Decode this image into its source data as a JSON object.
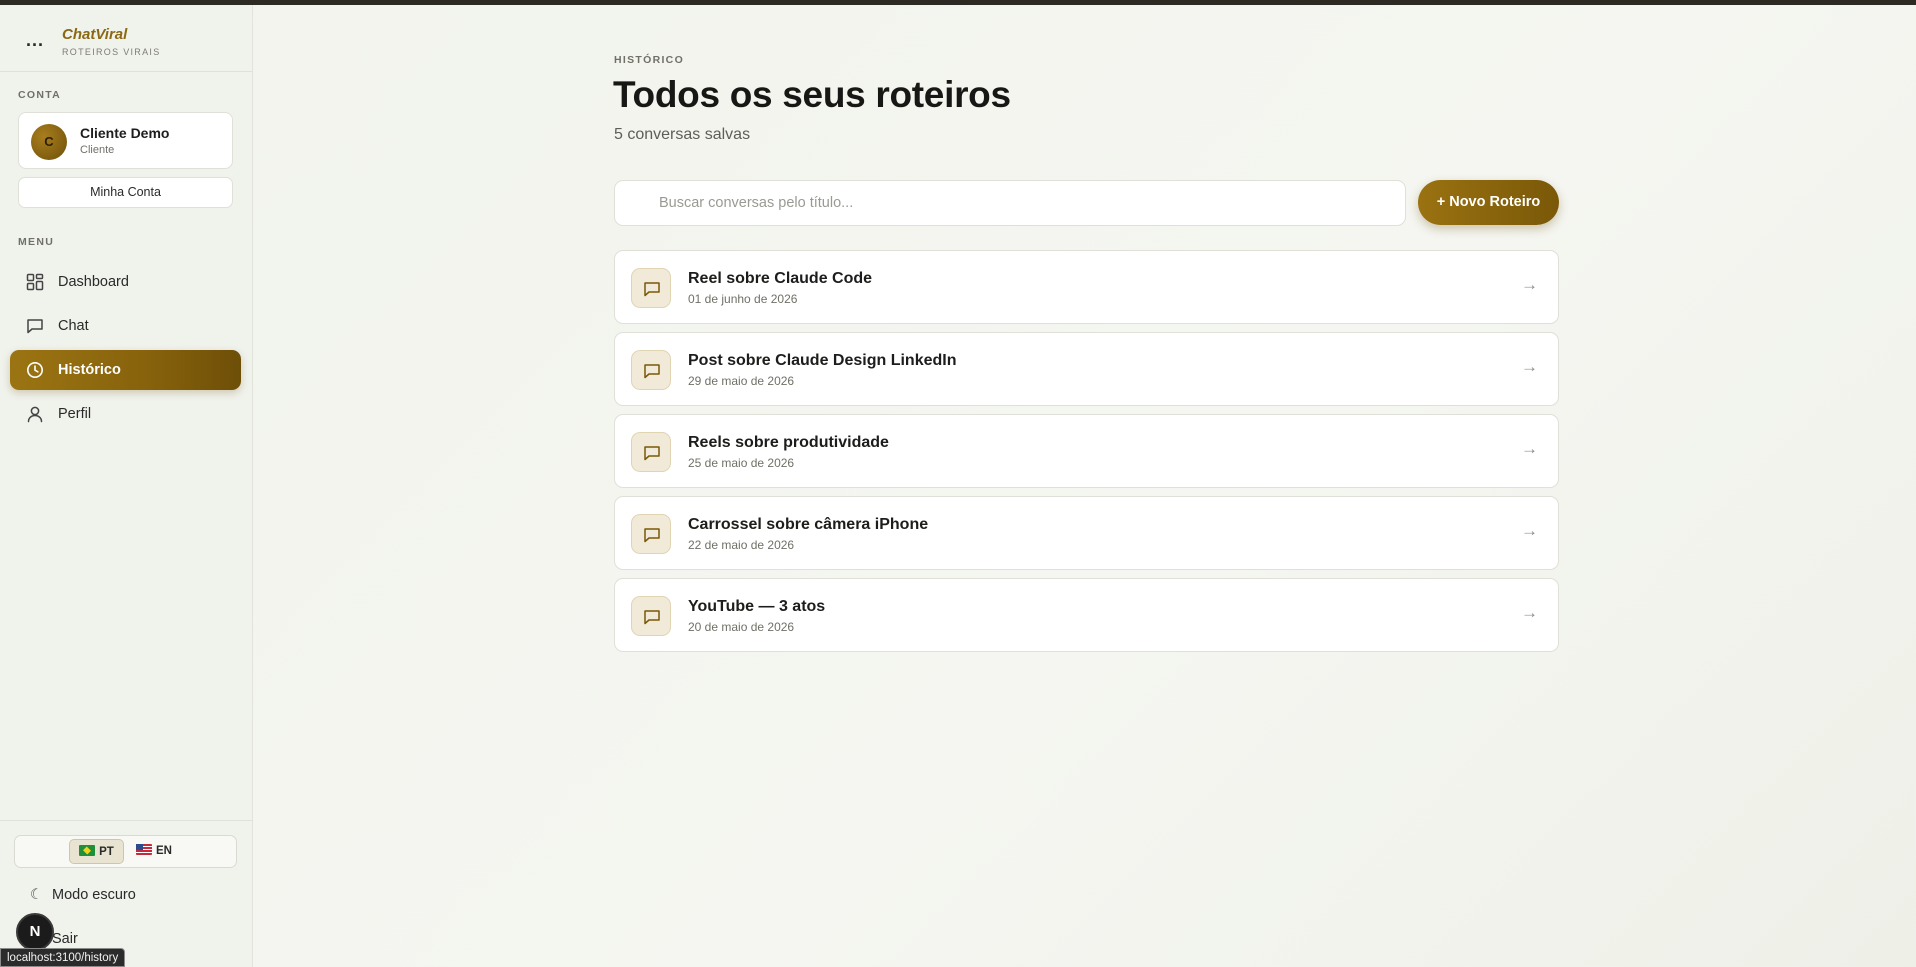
{
  "brand": {
    "name": "ChatViral",
    "tagline": "ROTEIROS VIRAIS",
    "menu_glyph": "..."
  },
  "account": {
    "section_label": "CONTA",
    "avatar_initial": "C",
    "name": "Cliente Demo",
    "role": "Cliente",
    "button_label": "Minha Conta"
  },
  "menu": {
    "section_label": "MENU",
    "items": [
      {
        "label": "Dashboard",
        "icon": "grid-icon",
        "active": false
      },
      {
        "label": "Chat",
        "icon": "chat-icon",
        "active": false
      },
      {
        "label": "Histórico",
        "icon": "clock-icon",
        "active": true
      },
      {
        "label": "Perfil",
        "icon": "user-icon",
        "active": false
      }
    ]
  },
  "language": {
    "pt_label": "PT",
    "en_label": "EN",
    "selected": "PT"
  },
  "bottom": {
    "dark_mode_label": "Modo escuro",
    "dark_mode_glyph": "☾",
    "logout_label": "Sair"
  },
  "overlay": {
    "badge": "N",
    "status_url": "localhost:3100/history"
  },
  "header": {
    "eyebrow": "HISTÓRICO",
    "title": "Todos os seus roteiros",
    "subtitle": "5 conversas salvas"
  },
  "search": {
    "placeholder": "Buscar conversas pelo título...",
    "value": ""
  },
  "new_button_label": "+ Novo Roteiro",
  "conversations": [
    {
      "title": "Reel sobre Claude Code",
      "date": "01 de junho de 2026"
    },
    {
      "title": "Post sobre Claude Design LinkedIn",
      "date": "29 de maio de 2026"
    },
    {
      "title": "Reels sobre produtividade",
      "date": "25 de maio de 2026"
    },
    {
      "title": "Carrossel sobre câmera iPhone",
      "date": "22 de maio de 2026"
    },
    {
      "title": "YouTube — 3 atos",
      "date": "20 de maio de 2026"
    }
  ],
  "arrow_glyph": "→",
  "colors": {
    "accent": "#8b6914",
    "accent_dark": "#6e4f08",
    "background": "#f1f3ec"
  }
}
